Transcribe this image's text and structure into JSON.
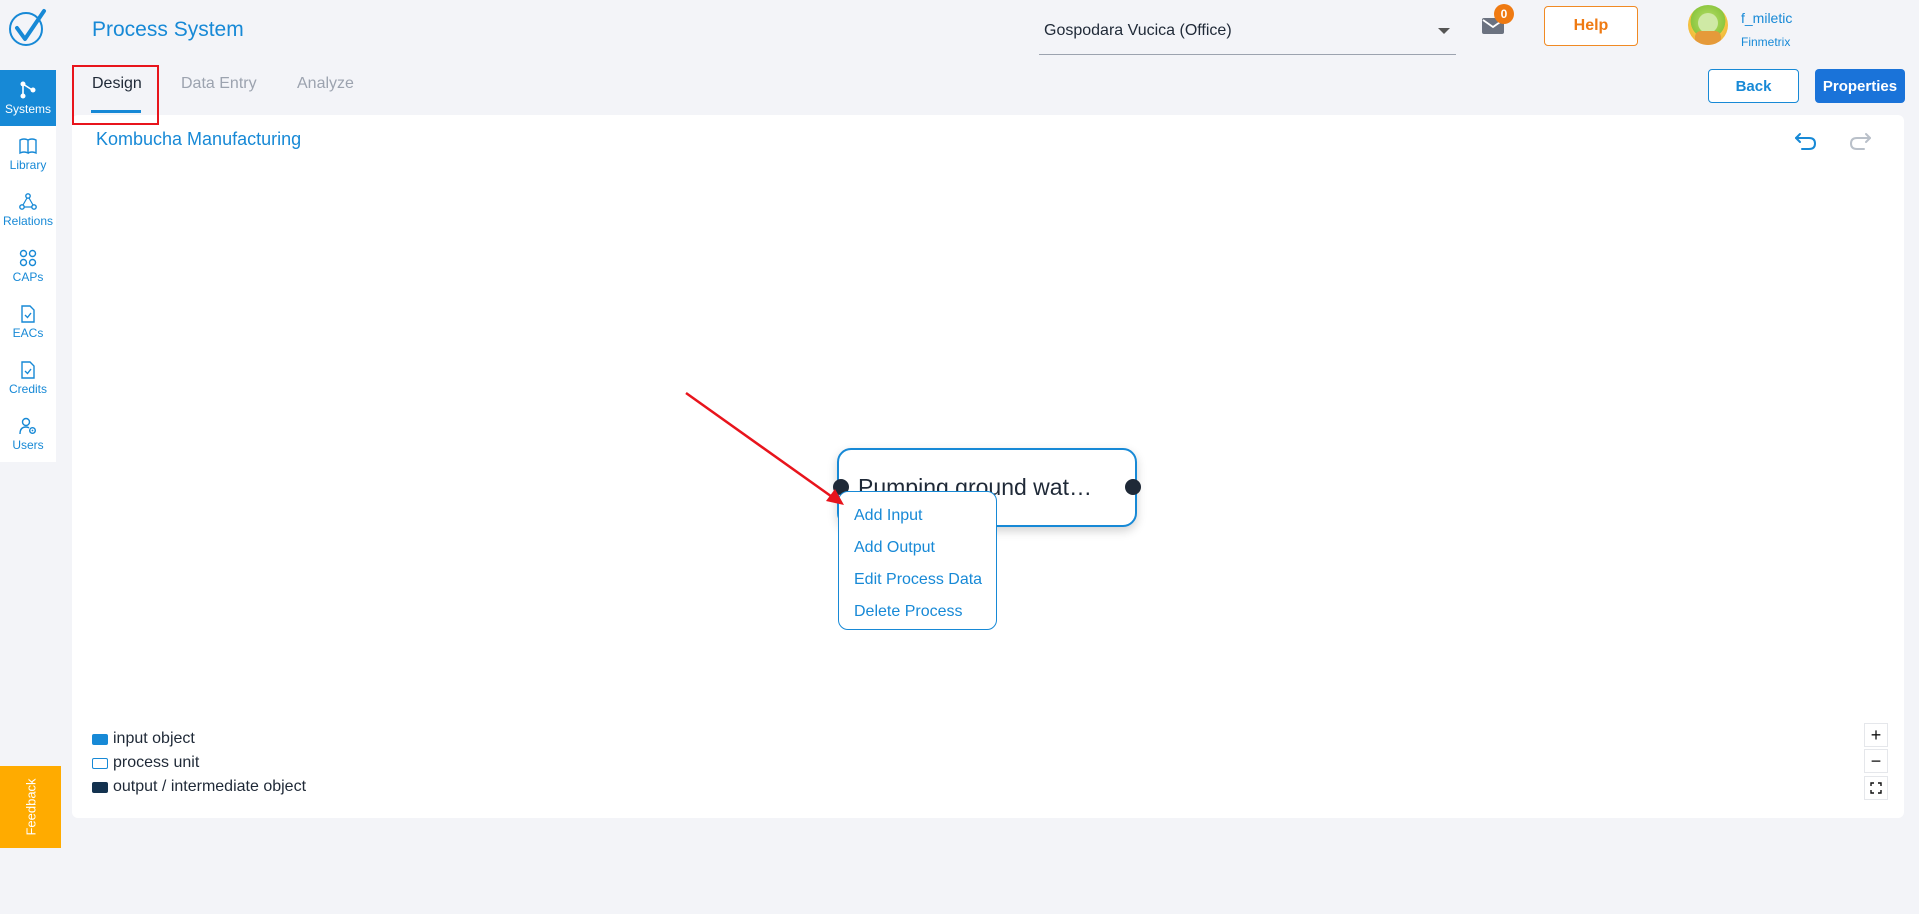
{
  "app": {
    "title": "Process System"
  },
  "sidebar": {
    "items": [
      {
        "label": "Systems",
        "icon": "systems-icon",
        "active": true
      },
      {
        "label": "Library",
        "icon": "book-icon"
      },
      {
        "label": "Relations",
        "icon": "relations-icon"
      },
      {
        "label": "CAPs",
        "icon": "grid-icon"
      },
      {
        "label": "EACs",
        "icon": "document-check-icon"
      },
      {
        "label": "Credits",
        "icon": "document-check-icon"
      },
      {
        "label": "Users",
        "icon": "users-gear-icon"
      }
    ]
  },
  "header": {
    "organization": "Gospodara Vucica (Office)",
    "mail_count": "0",
    "help_label": "Help",
    "user": {
      "name": "f_miletic",
      "org": "Finmetrix"
    }
  },
  "tabs": [
    {
      "label": "Design",
      "active": true
    },
    {
      "label": "Data Entry"
    },
    {
      "label": "Analyze"
    }
  ],
  "toolbar": {
    "back_label": "Back",
    "properties_label": "Properties"
  },
  "canvas": {
    "system_title": "Kombucha Manufacturing",
    "node_label": "Pumping ground wat…",
    "context_menu": [
      "Add Input",
      "Add Output",
      "Edit Process Data",
      "Delete Process"
    ]
  },
  "legend": [
    {
      "label": "input object",
      "kind": "input"
    },
    {
      "label": "process unit",
      "kind": "process"
    },
    {
      "label": "output / intermediate object",
      "kind": "output"
    }
  ],
  "zoom": {
    "in": "+",
    "out": "−"
  },
  "feedback_label": "Feedback",
  "colors": {
    "primary": "#1789d6",
    "accent": "#ef7a12",
    "annotation": "#e8141c",
    "feedback": "#ffab00"
  }
}
